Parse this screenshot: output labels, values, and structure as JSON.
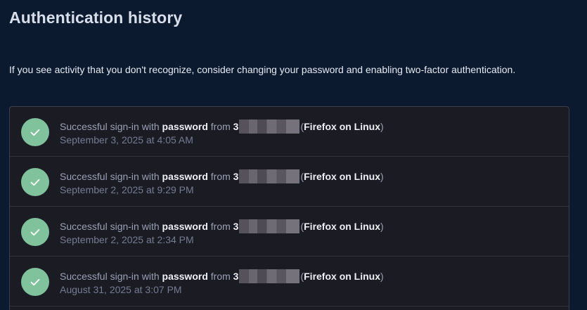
{
  "page": {
    "title": "Authentication history",
    "intro": "If you see activity that you don't recognize, consider changing your password and enabling two-factor authentication."
  },
  "history": {
    "entries": [
      {
        "prefix": "Successful sign-in with",
        "method": "password",
        "from_label": "from",
        "ip_visible": "3",
        "open_paren": "(",
        "client": "Firefox on Linux",
        "close_paren": ")",
        "timestamp": "September 3, 2025 at 4:05 AM",
        "status_icon": "check-icon",
        "status_color": "#7fc29b"
      },
      {
        "prefix": "Successful sign-in with",
        "method": "password",
        "from_label": "from",
        "ip_visible": "3",
        "open_paren": "(",
        "client": "Firefox on Linux",
        "close_paren": ")",
        "timestamp": "September 2, 2025 at 9:29 PM",
        "status_icon": "check-icon",
        "status_color": "#7fc29b"
      },
      {
        "prefix": "Successful sign-in with",
        "method": "password",
        "from_label": "from",
        "ip_visible": "3",
        "open_paren": "(",
        "client": "Firefox on Linux",
        "close_paren": ")",
        "timestamp": "September 2, 2025 at 2:34 PM",
        "status_icon": "check-icon",
        "status_color": "#7fc29b"
      },
      {
        "prefix": "Successful sign-in with",
        "method": "password",
        "from_label": "from",
        "ip_visible": "3",
        "open_paren": "(",
        "client": "Firefox on Linux",
        "close_paren": ")",
        "timestamp": "August 31, 2025 at 3:07 PM",
        "status_icon": "check-icon",
        "status_color": "#7fc29b"
      }
    ]
  }
}
